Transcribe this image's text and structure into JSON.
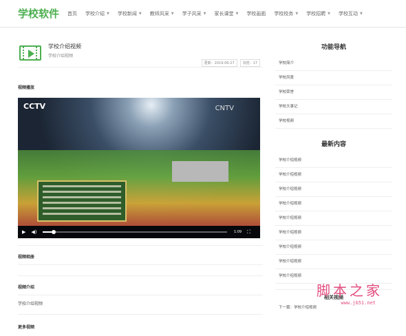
{
  "nav": {
    "logo": "学校软件",
    "items": [
      {
        "label": "首页",
        "dropdown": false
      },
      {
        "label": "学校介绍",
        "dropdown": true
      },
      {
        "label": "学校新闻",
        "dropdown": true
      },
      {
        "label": "教师风采",
        "dropdown": true
      },
      {
        "label": "学子风采",
        "dropdown": true
      },
      {
        "label": "家长课堂",
        "dropdown": true
      },
      {
        "label": "学校画面",
        "dropdown": false
      },
      {
        "label": "学校校务",
        "dropdown": true
      },
      {
        "label": "学校招聘",
        "dropdown": true
      },
      {
        "label": "学校互动",
        "dropdown": true
      }
    ]
  },
  "video": {
    "title": "学校介绍视频",
    "subtitle": "学校介绍视频",
    "updated": "更新：2019-06-27",
    "views": "浏览：17",
    "section_play": "视频播放",
    "player": {
      "time": "1:09",
      "progress": 0.06,
      "logo": "CCTV",
      "logo_right": "CNTV"
    },
    "section_album": "视频相册",
    "section_intro": "视频介绍",
    "intro_text": "学校介绍视频",
    "section_more": "更多视频"
  },
  "sidebar": {
    "nav_title": "功能导航",
    "nav_items": [
      "学校简介",
      "学校风景",
      "学校荣誉",
      "学校大事记",
      "学校视频"
    ],
    "latest_title": "最新内容",
    "latest_items": [
      "学校介绍视频",
      "学校介绍视频",
      "学校介绍视频",
      "学校介绍视频",
      "学校介绍视频",
      "学校介绍视频",
      "学校介绍视频",
      "学校介绍视频",
      "学校介绍视频"
    ],
    "related_title": "相关视频",
    "related_item": "下一篇：学校介绍视频"
  },
  "watermark": {
    "text": "脚本之家",
    "url": "www.jb51.net",
    "color": "#e24b7f"
  },
  "colors": {
    "accent": "#4caf50"
  },
  "icons": {
    "video": "video-film-icon",
    "play": "play-icon",
    "volume": "volume-icon",
    "fullscreen": "fullscreen-icon",
    "caret": "chevron-down-icon"
  }
}
